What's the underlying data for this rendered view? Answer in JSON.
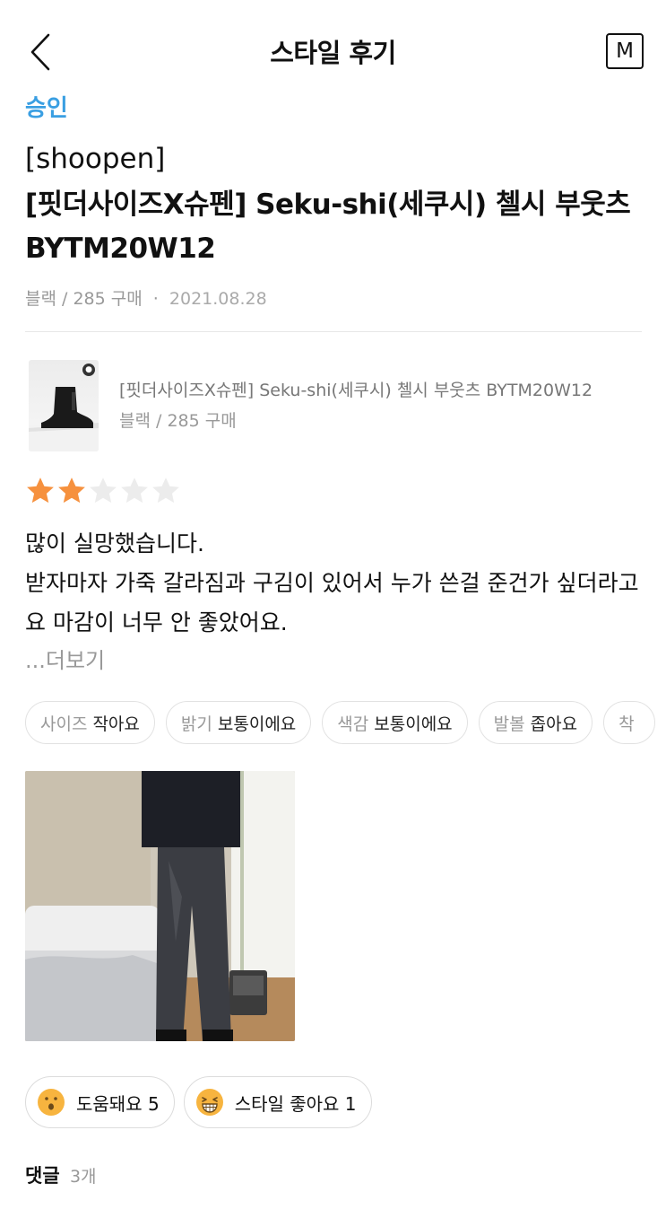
{
  "header": {
    "title": "스타일 후기",
    "m_button": "M"
  },
  "status": "승인",
  "product": {
    "brand": "[shoopen]",
    "name": "[핏더사이즈X슈펜] Seku-shi(세쿠시) 첼시 부웃츠 BYTM20W12",
    "option": "블랙",
    "size": "285",
    "purchase_label": "구매",
    "date": "2021.08.28"
  },
  "card": {
    "name": "[핏더사이즈X슈펜] Seku-shi(세쿠시) 첼시 부웃츠 BYTM20W12",
    "option_line": "블랙 / 285  구매"
  },
  "rating": {
    "value": 2,
    "max": 5
  },
  "review": {
    "line1": "많이 실망했습니다.",
    "line2": "받자마자 가죽 갈라짐과 구김이 있어서 누가 쓴걸 준건가 싶더라고요 마감이 너무 안 좋았어요.",
    "more": "...더보기"
  },
  "tags": [
    {
      "key": "사이즈",
      "value": "작아요"
    },
    {
      "key": "밝기",
      "value": "보통이에요"
    },
    {
      "key": "색감",
      "value": "보통이에요"
    },
    {
      "key": "발볼",
      "value": "좁아요"
    },
    {
      "key": "착",
      "value": ""
    }
  ],
  "reactions": {
    "helpful": "도움돼요 5",
    "style_like": "스타일 좋아요 1"
  },
  "comments": {
    "label": "댓글",
    "count": "3개"
  },
  "colors": {
    "status": "#3a9fe2",
    "star_on": "#f6913e",
    "star_off": "#ececec",
    "emoji": "#f7b43f"
  }
}
